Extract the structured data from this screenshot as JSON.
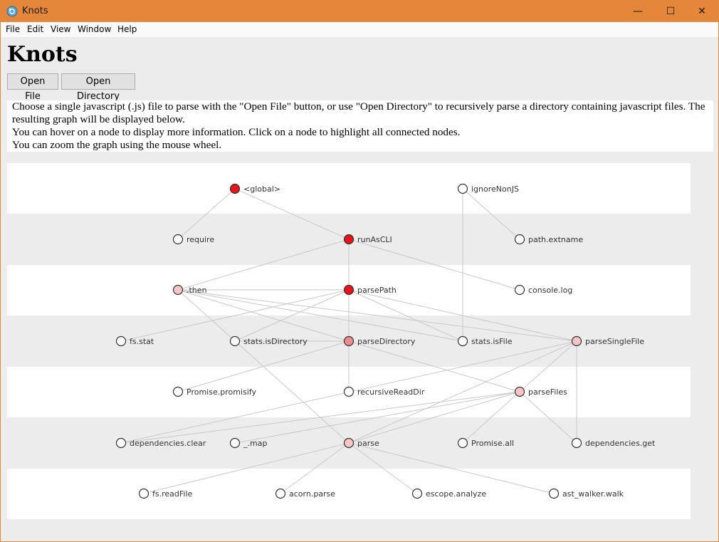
{
  "window": {
    "title": "Knots",
    "minimize": "—",
    "maximize": "☐",
    "close": "✕"
  },
  "menu": [
    "File",
    "Edit",
    "View",
    "Window",
    "Help"
  ],
  "header": {
    "title": "Knots",
    "open_file": "Open File",
    "open_directory": "Open Directory"
  },
  "intro": [
    "Choose a single javascript (.js) file to parse with the \"Open File\" button, or use \"Open Directory\" to recursively parse a directory containing javascript files. The resulting graph will be displayed below.",
    "You can hover on a node to display more information. Click on a node to highlight all connected nodes.",
    "You can zoom the graph using the mouse wheel."
  ],
  "colors": {
    "accent": "#e5873a",
    "node_high": "#e8141c",
    "node_mid": "#f08a8c",
    "node_low": "#f8c4c6",
    "node_none": "#ffffff",
    "edge": "#c8c8c8",
    "band_light": "#ffffff",
    "band_dark": "#ececec"
  },
  "graph": {
    "nodes": [
      {
        "id": "global",
        "label": "<global>",
        "level": "high"
      },
      {
        "id": "ignoreNonJS",
        "label": "ignoreNonJS",
        "level": "none"
      },
      {
        "id": "require",
        "label": "require",
        "level": "none"
      },
      {
        "id": "runAsCLI",
        "label": "runAsCLI",
        "level": "high"
      },
      {
        "id": "pathext",
        "label": "path.extname",
        "level": "none"
      },
      {
        "id": "then",
        "label": ".then",
        "level": "low"
      },
      {
        "id": "parsePath",
        "label": "parsePath",
        "level": "high"
      },
      {
        "id": "consolelog",
        "label": "console.log",
        "level": "none"
      },
      {
        "id": "fsstat",
        "label": "fs.stat",
        "level": "none"
      },
      {
        "id": "statsIsDir",
        "label": "stats.isDirectory",
        "level": "none"
      },
      {
        "id": "parseDirectory",
        "label": "parseDirectory",
        "level": "mid"
      },
      {
        "id": "statsIsFile",
        "label": "stats.isFile",
        "level": "none"
      },
      {
        "id": "parseSingleFile",
        "label": "parseSingleFile",
        "level": "low"
      },
      {
        "id": "promisify",
        "label": "Promise.promisify",
        "level": "none"
      },
      {
        "id": "recursiveReadDir",
        "label": "recursiveReadDir",
        "level": "none"
      },
      {
        "id": "parseFiles",
        "label": "parseFiles",
        "level": "low"
      },
      {
        "id": "depclear",
        "label": "dependencies.clear",
        "level": "none"
      },
      {
        "id": "map",
        "label": "_.map",
        "level": "none"
      },
      {
        "id": "parse",
        "label": "parse",
        "level": "low"
      },
      {
        "id": "promiseall",
        "label": "Promise.all",
        "level": "none"
      },
      {
        "id": "depget",
        "label": "dependencies.get",
        "level": "none"
      },
      {
        "id": "fsreadfile",
        "label": "fs.readFile",
        "level": "none"
      },
      {
        "id": "acornparse",
        "label": "acorn.parse",
        "level": "none"
      },
      {
        "id": "escope",
        "label": "escope.analyze",
        "level": "none"
      },
      {
        "id": "astwalker",
        "label": "ast_walker.walk",
        "level": "none"
      }
    ],
    "links": [
      [
        "global",
        "require"
      ],
      [
        "global",
        "runAsCLI"
      ],
      [
        "ignoreNonJS",
        "pathext"
      ],
      [
        "ignoreNonJS",
        "statsIsFile"
      ],
      [
        "runAsCLI",
        "then"
      ],
      [
        "runAsCLI",
        "parsePath"
      ],
      [
        "runAsCLI",
        "consolelog"
      ],
      [
        "then",
        "parsePath"
      ],
      [
        "then",
        "parseDirectory"
      ],
      [
        "then",
        "statsIsFile"
      ],
      [
        "then",
        "parseSingleFile"
      ],
      [
        "then",
        "parse"
      ],
      [
        "parsePath",
        "fsstat"
      ],
      [
        "parsePath",
        "statsIsDir"
      ],
      [
        "parsePath",
        "parseDirectory"
      ],
      [
        "parsePath",
        "statsIsFile"
      ],
      [
        "parsePath",
        "parseSingleFile"
      ],
      [
        "parseDirectory",
        "promisify"
      ],
      [
        "parseDirectory",
        "recursiveReadDir"
      ],
      [
        "parseDirectory",
        "parseFiles"
      ],
      [
        "parseDirectory",
        "statsIsDir"
      ],
      [
        "parseSingleFile",
        "depclear"
      ],
      [
        "parseSingleFile",
        "parse"
      ],
      [
        "parseSingleFile",
        "depget"
      ],
      [
        "parseSingleFile",
        "parseFiles"
      ],
      [
        "parseFiles",
        "depclear"
      ],
      [
        "parseFiles",
        "map"
      ],
      [
        "parseFiles",
        "parse"
      ],
      [
        "parseFiles",
        "promiseall"
      ],
      [
        "parseFiles",
        "depget"
      ],
      [
        "parse",
        "fsreadfile"
      ],
      [
        "parse",
        "acornparse"
      ],
      [
        "parse",
        "escope"
      ],
      [
        "parse",
        "astwalker"
      ]
    ]
  }
}
